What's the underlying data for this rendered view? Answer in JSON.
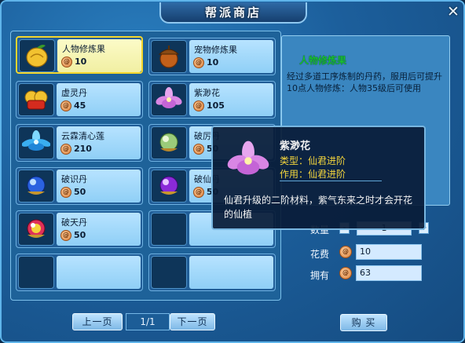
{
  "window": {
    "title": "帮派商店",
    "close": "✕"
  },
  "items": [
    {
      "name": "人物修炼果",
      "price": "10",
      "icon": "golden-fruit-icon",
      "selected": true
    },
    {
      "name": "宠物修炼果",
      "price": "10",
      "icon": "acorn-icon"
    },
    {
      "name": "虚灵丹",
      "price": "45",
      "icon": "red-gold-pill-icon"
    },
    {
      "name": "紫渺花",
      "price": "105",
      "icon": "purple-flower-icon"
    },
    {
      "name": "云霖清心莲",
      "price": "210",
      "icon": "blue-lotus-icon"
    },
    {
      "name": "破厉丹",
      "price": "50",
      "icon": "green-orb-icon"
    },
    {
      "name": "破识丹",
      "price": "50",
      "icon": "blue-orb-icon"
    },
    {
      "name": "破仙丹",
      "price": "50",
      "icon": "purple-orb-icon"
    },
    {
      "name": "破天丹",
      "price": "50",
      "icon": "rainbow-orb-icon"
    }
  ],
  "detail": {
    "name": "人物修炼果",
    "description": "经过多道工序炼制的丹药，服用后可提升10点人物修炼：人物35级后可使用"
  },
  "purchase": {
    "quantity_label": "数量",
    "quantity_value": "1",
    "minus": "-",
    "plus": "+",
    "cost_label": "花费",
    "cost_value": "10",
    "owned_label": "拥有",
    "owned_value": "63",
    "buy_label": "购 买"
  },
  "pagination": {
    "prev": "上一页",
    "indicator": "1/1",
    "next": "下一页"
  },
  "tooltip": {
    "name": "紫渺花",
    "type": "类型：仙君进阶",
    "use": "作用：仙君进阶",
    "description": "仙君升级的二阶材料，紫气东来之时才会开花的仙植"
  },
  "colors": {
    "selected_border": "#f3d62d",
    "detail_name": "#18c22f",
    "tooltip_accent": "#f3d43c"
  }
}
